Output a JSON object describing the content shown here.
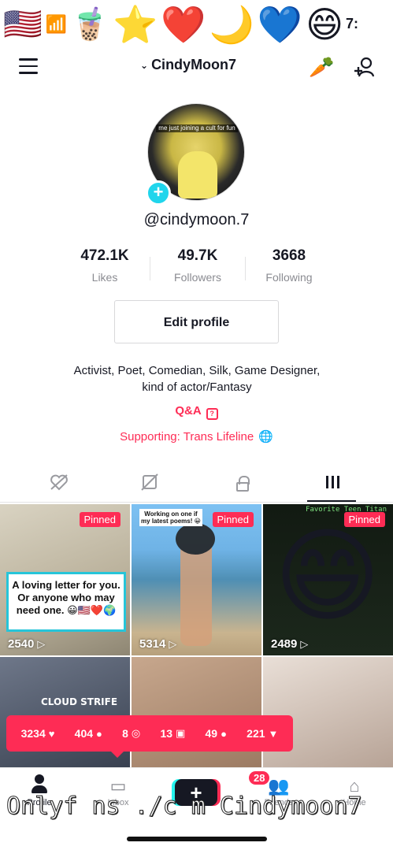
{
  "status": {
    "emojis": [
      "🇺🇸",
      "🧋",
      "⭐",
      "❤️",
      "🌙",
      "💙",
      "😄"
    ],
    "wifi": "📶",
    "time": "7:"
  },
  "header": {
    "username": "CindyMoon7",
    "chevron": "⌄",
    "carrot": "🥕"
  },
  "profile": {
    "avatar_caption": "me just joining a cult for fun",
    "add_icon": "+",
    "handle": "@cindymoon.7",
    "stats": [
      {
        "value": "3668",
        "label": "Following"
      },
      {
        "value": "49.7K",
        "label": "Followers"
      },
      {
        "value": "472.1K",
        "label": "Likes"
      }
    ],
    "edit_button": "Edit profile",
    "bio_line1": "Activist, Poet, Comedian, Silk, Game Designer,",
    "bio_line2": "kind of actor/Fantasy",
    "qa": "Q&A",
    "qa_icon": "?",
    "supporting": "Supporting: Trans Lifeline",
    "globe_icon": "🌐"
  },
  "tabs": {
    "videos_icon": "grid-icon",
    "private_icon": "lock-icon",
    "reposts_icon": "repost-icon",
    "liked_icon": "heart-icon"
  },
  "videos": [
    {
      "pinned": "Pinned",
      "views": "2540",
      "overlay": "A loving letter for you. Or anyone who may need one. 😀🇺🇸❤️🌍"
    },
    {
      "pinned": "Pinned",
      "views": "5314",
      "overlay": "Working on one if my latest poems! 😀"
    },
    {
      "pinned": "Pinned",
      "views": "2489",
      "overlay": "Favorite Teen Titan"
    },
    {
      "overlay": "CLOUD STRIFE"
    },
    {
      "overlay": ""
    },
    {
      "overlay": ""
    }
  ],
  "video_stats": {
    "likes": "3234",
    "comments": "404",
    "saves": "8",
    "shares_icon_value": "13",
    "followers": "49",
    "views": "221"
  },
  "nav": {
    "home": "Home",
    "friends": "Friends",
    "friends_badge": "28",
    "add": "+",
    "inbox": "Inbox",
    "profile": "Profile"
  },
  "watermark": "Onlyf ns ./c m Cindymoon7"
}
